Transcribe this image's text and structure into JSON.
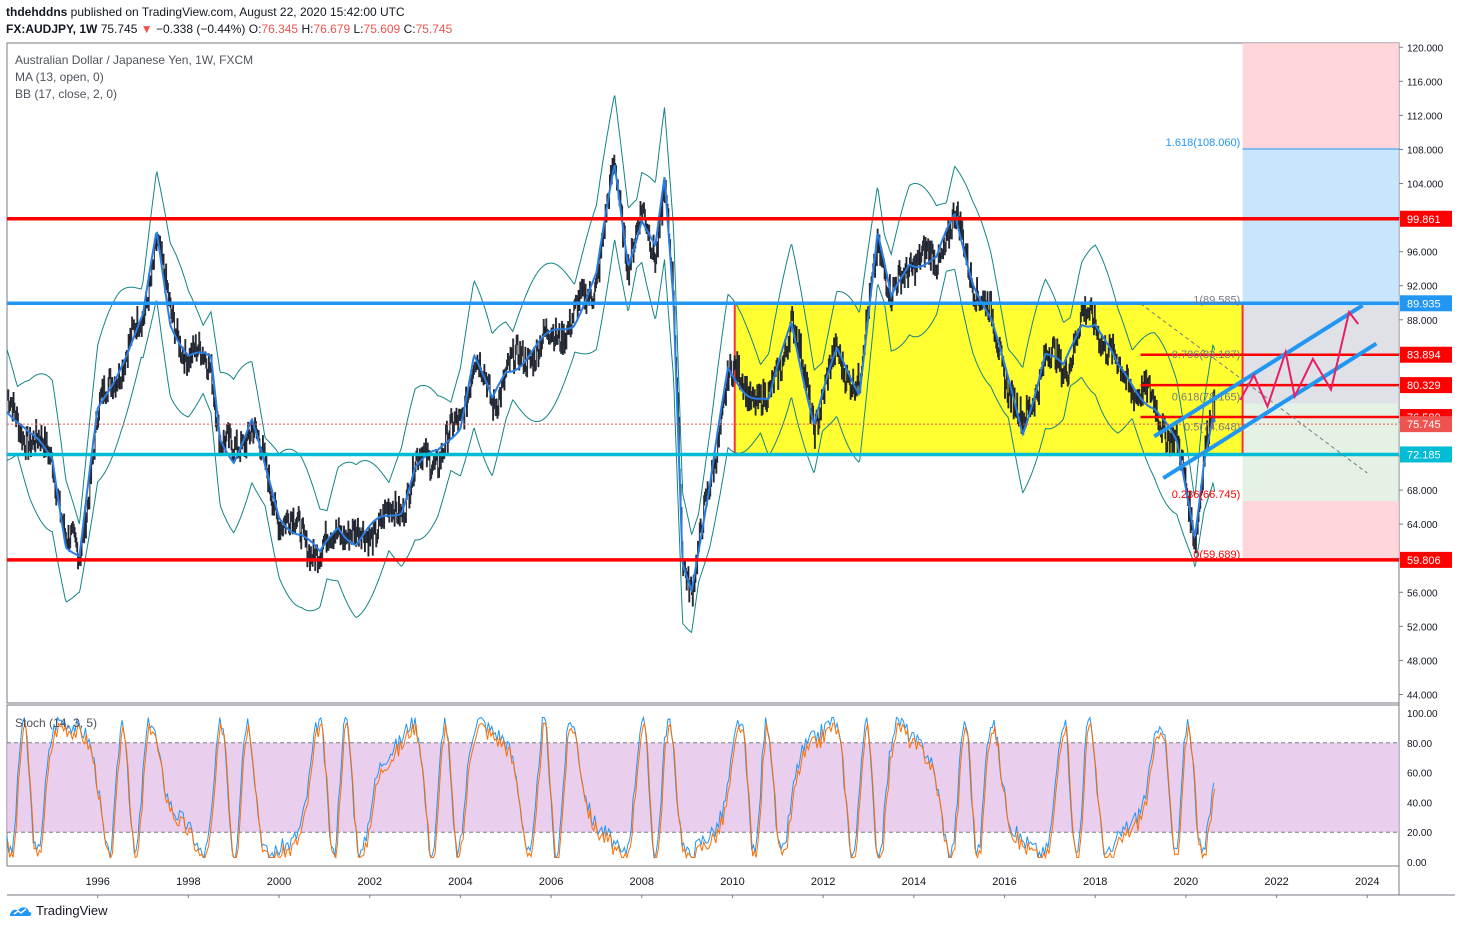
{
  "header": {
    "author": "thdehddns",
    "published": "published on TradingView.com, August 22, 2020 15:42:00 UTC",
    "symbol": "FX:AUDJPY, 1W",
    "last": "75.745",
    "change": "−0.338 (−0.44%)",
    "open_label": "O:",
    "open": "76.345",
    "high_label": "H:",
    "high": "76.679",
    "low_label": "L:",
    "low": "75.609",
    "close_label": "C:",
    "close": "75.745"
  },
  "legend": {
    "title": "Australian Dollar / Japanese Yen, 1W, FXCM",
    "ma": "MA (13, open, 0)",
    "bb": "BB (17, close, 2, 0)",
    "stoch": "Stoch (14, 3, 5)"
  },
  "brand": "TradingView",
  "colors": {
    "red": "#ff0000",
    "blue": "#2196f3",
    "cyan": "#00bcd4",
    "yellow": "#ffff00",
    "bb": "#138484",
    "ma": "#2a7de1",
    "pink": "#e91e63",
    "stoch_bg": "#e1bee7"
  },
  "chart_data": [
    {
      "type": "line",
      "title": "Australian Dollar / Japanese Yen, 1W, FXCM",
      "x_ticks": [
        "1996",
        "1998",
        "2000",
        "2002",
        "2004",
        "2006",
        "2008",
        "2010",
        "2012",
        "2014",
        "2016",
        "2018",
        "2020",
        "2022",
        "2024"
      ],
      "y_ticks": [
        "120.000",
        "116.000",
        "112.000",
        "108.000",
        "104.000",
        "100.000",
        "96.000",
        "92.000",
        "88.000",
        "84.000",
        "80.000",
        "76.000",
        "72.000",
        "68.000",
        "64.000",
        "60.000",
        "56.000",
        "52.000",
        "48.000",
        "44.000"
      ],
      "ylim": [
        43,
        120.5
      ],
      "xlim": [
        1994,
        2024.7
      ],
      "series_points": [
        [
          1994.0,
          78
        ],
        [
          1994.5,
          74
        ],
        [
          1995.0,
          72
        ],
        [
          1995.3,
          62
        ],
        [
          1995.6,
          60
        ],
        [
          1996.0,
          77
        ],
        [
          1996.5,
          83
        ],
        [
          1997.0,
          88
        ],
        [
          1997.3,
          98
        ],
        [
          1997.6,
          88
        ],
        [
          1998.0,
          84
        ],
        [
          1998.5,
          83
        ],
        [
          1998.7,
          74
        ],
        [
          1999.0,
          72
        ],
        [
          1999.4,
          76
        ],
        [
          1999.7,
          70
        ],
        [
          2000.0,
          65
        ],
        [
          2000.5,
          63
        ],
        [
          2000.9,
          60
        ],
        [
          2001.3,
          64
        ],
        [
          2001.7,
          62
        ],
        [
          2002.2,
          64
        ],
        [
          2002.7,
          66
        ],
        [
          2003.0,
          71
        ],
        [
          2003.5,
          72
        ],
        [
          2004.0,
          76
        ],
        [
          2004.3,
          84
        ],
        [
          2004.7,
          78
        ],
        [
          2005.0,
          82
        ],
        [
          2005.5,
          84
        ],
        [
          2006.0,
          86
        ],
        [
          2006.5,
          88
        ],
        [
          2007.0,
          93
        ],
        [
          2007.4,
          106
        ],
        [
          2007.7,
          95
        ],
        [
          2008.0,
          100
        ],
        [
          2008.3,
          96
        ],
        [
          2008.5,
          104
        ],
        [
          2008.7,
          90
        ],
        [
          2008.9,
          60
        ],
        [
          2009.1,
          57
        ],
        [
          2009.5,
          68
        ],
        [
          2009.9,
          82
        ],
        [
          2010.3,
          80
        ],
        [
          2010.8,
          78
        ],
        [
          2011.3,
          88
        ],
        [
          2011.8,
          76
        ],
        [
          2012.3,
          84
        ],
        [
          2012.8,
          80
        ],
        [
          2013.2,
          98
        ],
        [
          2013.5,
          90
        ],
        [
          2013.9,
          95
        ],
        [
          2014.5,
          95
        ],
        [
          2014.9,
          100
        ],
        [
          2015.3,
          93
        ],
        [
          2015.7,
          88
        ],
        [
          2016.0,
          82
        ],
        [
          2016.4,
          75
        ],
        [
          2016.9,
          84
        ],
        [
          2017.3,
          82
        ],
        [
          2017.7,
          88
        ],
        [
          2018.0,
          88
        ],
        [
          2018.5,
          82
        ],
        [
          2018.9,
          80
        ],
        [
          2019.3,
          78
        ],
        [
          2019.8,
          73
        ],
        [
          2020.2,
          63
        ],
        [
          2020.4,
          72
        ],
        [
          2020.6,
          77
        ],
        [
          2020.65,
          75.745
        ]
      ],
      "horizontal_levels": [
        {
          "value": 99.861,
          "label": "99.861",
          "color": "#ff0000"
        },
        {
          "value": 89.935,
          "label": "89.935",
          "color": "#2196f3"
        },
        {
          "value": 83.894,
          "label": "83.894",
          "color": "#ff0000"
        },
        {
          "value": 80.329,
          "label": "80.329",
          "color": "#ff0000"
        },
        {
          "value": 76.58,
          "label": "76.580",
          "color": "#ff0000"
        },
        {
          "value": 75.745,
          "label": "75.745",
          "color": "#ef5350"
        },
        {
          "value": 72.185,
          "label": "72.185",
          "color": "#00bcd4"
        },
        {
          "value": 59.806,
          "label": "59.806",
          "color": "#ff0000"
        }
      ],
      "fib_labels": [
        {
          "label": "1.618(108.060)",
          "value": 108.06
        },
        {
          "label": "1(89.585)",
          "value": 89.585
        },
        {
          "label": "0.786(83.187)",
          "value": 83.187
        },
        {
          "label": "0.618(78.165)",
          "value": 78.165
        },
        {
          "label": "0.5(74.648)",
          "value": 74.648
        },
        {
          "label": "0.236(66.745)",
          "value": 66.745
        },
        {
          "label": "0(59.689)",
          "value": 59.689
        }
      ],
      "range_box": {
        "x0": 2010.05,
        "x1": 2021.25,
        "y0": 72.185,
        "y1": 89.935
      }
    },
    {
      "type": "line",
      "title": "Stoch (14, 3, 5)",
      "y_ticks": [
        "100.00",
        "80.00",
        "60.00",
        "40.00",
        "20.00",
        "0.00"
      ],
      "ylim": [
        0,
        100
      ],
      "bands": [
        20,
        80
      ]
    }
  ]
}
